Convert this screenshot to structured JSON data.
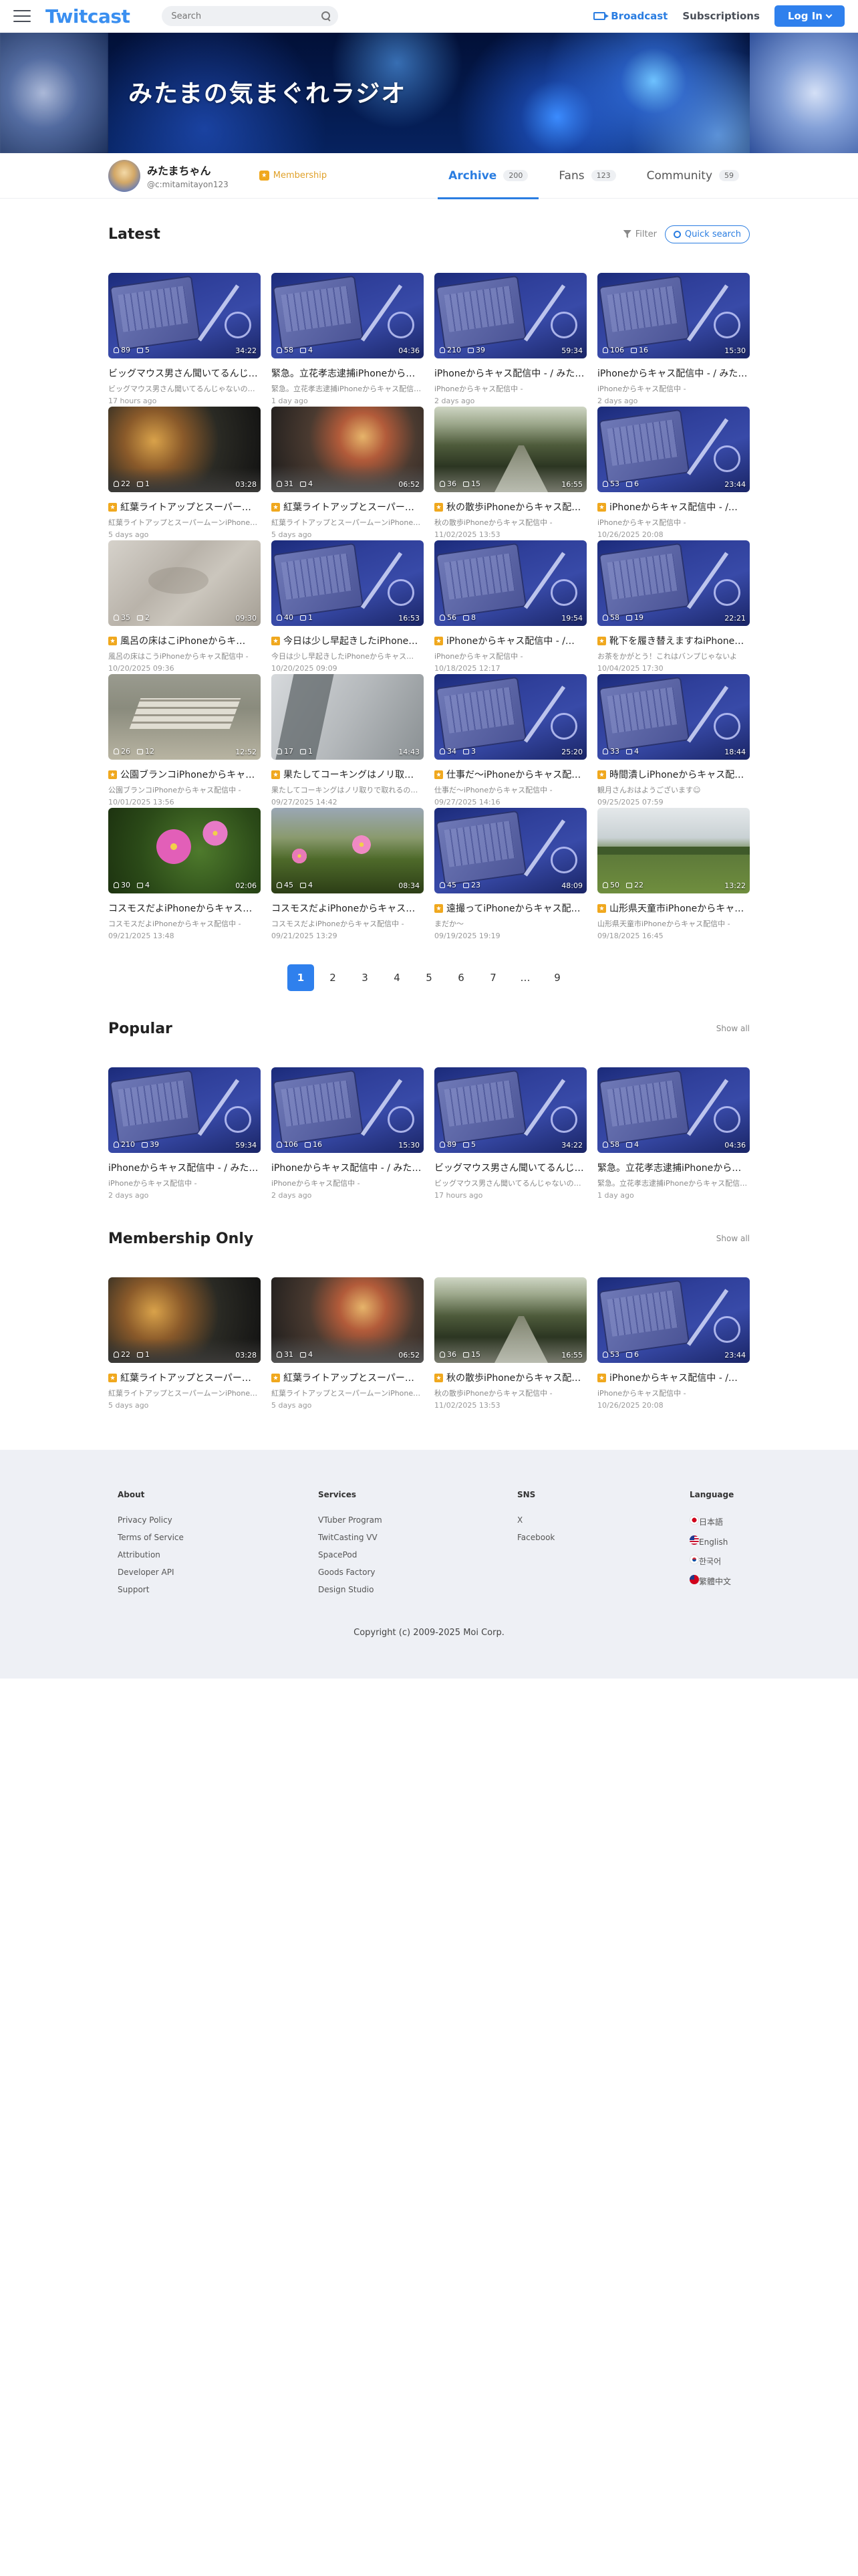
{
  "header": {
    "logo": "Twitcast",
    "search_placeholder": "Search",
    "broadcast": "Broadcast",
    "subscriptions": "Subscriptions",
    "login": "Log In"
  },
  "banner": {
    "title": "みたまの気まぐれラジオ"
  },
  "profile": {
    "name": "みたまちゃん",
    "id": "@c:mitamitayon123",
    "membership": "Membership",
    "tabs": [
      {
        "label": "Archive",
        "count": "200"
      },
      {
        "label": "Fans",
        "count": "123"
      },
      {
        "label": "Community",
        "count": "59"
      }
    ]
  },
  "latest": {
    "title": "Latest",
    "filter": "Filter",
    "quick_search": "Quick search",
    "items": [
      {
        "views": "89",
        "comments": "5",
        "duration": "34:22",
        "title": "ビッグマウス男さん聞いてるんじゃ…",
        "sub": "ビッグマウス男さん聞いてるんじゃないの…",
        "date": "17 hours ago",
        "member": false,
        "thumb": "phone"
      },
      {
        "views": "58",
        "comments": "4",
        "duration": "04:36",
        "title": "緊急。立花孝志逮捕iPhoneから…",
        "sub": "緊急。立花孝志逮捕iPhoneからキャス配信…",
        "date": "1 day ago",
        "member": false,
        "thumb": "phone"
      },
      {
        "views": "210",
        "comments": "39",
        "duration": "59:34",
        "title": "iPhoneからキャス配信中 - / みた…",
        "sub": "iPhoneからキャス配信中 -",
        "date": "2 days ago",
        "member": false,
        "thumb": "phone"
      },
      {
        "views": "106",
        "comments": "16",
        "duration": "15:30",
        "title": "iPhoneからキャス配信中 - / みた…",
        "sub": "iPhoneからキャス配信中 -",
        "date": "2 days ago",
        "member": false,
        "thumb": "phone"
      },
      {
        "views": "22",
        "comments": "1",
        "duration": "03:28",
        "title": "紅葉ライトアップとスーパー…",
        "sub": "紅葉ライトアップとスーパームーンiPhone…",
        "date": "5 days ago",
        "member": true,
        "thumb": "autumn"
      },
      {
        "views": "31",
        "comments": "4",
        "duration": "06:52",
        "title": "紅葉ライトアップとスーパー…",
        "sub": "紅葉ライトアップとスーパームーンiPhone…",
        "date": "5 days ago",
        "member": true,
        "thumb": "autumn2"
      },
      {
        "views": "36",
        "comments": "15",
        "duration": "16:55",
        "title": "秋の散歩iPhoneからキャス配…",
        "sub": "秋の散歩iPhoneからキャス配信中 -",
        "date": "11/02/2025 13:53",
        "member": true,
        "thumb": "forest"
      },
      {
        "views": "53",
        "comments": "6",
        "duration": "23:44",
        "title": "iPhoneからキャス配信中 - /…",
        "sub": "iPhoneからキャス配信中 -",
        "date": "10/26/2025 20:08",
        "member": true,
        "thumb": "phone"
      },
      {
        "views": "35",
        "comments": "2",
        "duration": "09:30",
        "title": "風呂の床はこiPhoneからキ…",
        "sub": "風呂の床はこうiPhoneからキャス配信中 -",
        "date": "10/20/2025 09:36",
        "member": true,
        "thumb": "floor"
      },
      {
        "views": "40",
        "comments": "1",
        "duration": "16:53",
        "title": "今日は少し早起きしたiPhone…",
        "sub": "今日は少し早起きしたiPhoneからキャス…",
        "date": "10/20/2025 09:09",
        "member": true,
        "thumb": "phone"
      },
      {
        "views": "56",
        "comments": "8",
        "duration": "19:54",
        "title": "iPhoneからキャス配信中 - /…",
        "sub": "iPhoneからキャス配信中 -",
        "date": "10/18/2025 12:17",
        "member": true,
        "thumb": "phone"
      },
      {
        "views": "58",
        "comments": "19",
        "duration": "22:21",
        "title": "靴下を履き替えますねiPhone…",
        "sub": "お茶をかがとう！これはバンプじゃないよ",
        "date": "10/04/2025 17:30",
        "member": true,
        "thumb": "phone"
      },
      {
        "views": "26",
        "comments": "12",
        "duration": "12:52",
        "title": "公園ブランコiPhoneからキャ…",
        "sub": "公園ブランコiPhoneからキャス配信中 -",
        "date": "10/01/2025 13:56",
        "member": true,
        "thumb": "bench"
      },
      {
        "views": "17",
        "comments": "1",
        "duration": "14:43",
        "title": "果たしてコーキングはノリ取…",
        "sub": "果たしてコーキングはノリ取りで取れるの…",
        "date": "09/27/2025 14:42",
        "member": true,
        "thumb": "room"
      },
      {
        "views": "34",
        "comments": "3",
        "duration": "25:20",
        "title": "仕事だ〜iPhoneからキャス配…",
        "sub": "仕事だ〜iPhoneからキャス配信中 -",
        "date": "09/27/2025 14:16",
        "member": true,
        "thumb": "phone"
      },
      {
        "views": "33",
        "comments": "4",
        "duration": "18:44",
        "title": "時間潰しiPhoneからキャス配…",
        "sub": "観月さんおはようございます☺",
        "date": "09/25/2025 07:59",
        "member": true,
        "thumb": "phone"
      },
      {
        "views": "30",
        "comments": "4",
        "duration": "02:06",
        "title": "コスモスだよiPhoneからキャス…",
        "sub": "コスモスだよiPhoneからキャス配信中 -",
        "date": "09/21/2025 13:48",
        "member": false,
        "thumb": "cosmos"
      },
      {
        "views": "45",
        "comments": "4",
        "duration": "08:34",
        "title": "コスモスだよiPhoneからキャス…",
        "sub": "コスモスだよiPhoneからキャス配信中 -",
        "date": "09/21/2025 13:29",
        "member": false,
        "thumb": "cosmos2"
      },
      {
        "views": "45",
        "comments": "23",
        "duration": "48:09",
        "title": "遠撮ってiPhoneからキャス配…",
        "sub": "まだか〜",
        "date": "09/19/2025 19:19",
        "member": true,
        "thumb": "phone"
      },
      {
        "views": "50",
        "comments": "22",
        "duration": "13:22",
        "title": "山形県天童市iPhoneからキャ…",
        "sub": "山形県天童市iPhoneからキャス配信中 -",
        "date": "09/18/2025 16:45",
        "member": true,
        "thumb": "field"
      }
    ]
  },
  "pagination": [
    "1",
    "2",
    "3",
    "4",
    "5",
    "6",
    "7",
    "…",
    "9"
  ],
  "popular": {
    "title": "Popular",
    "show_all": "Show all",
    "items": [
      {
        "views": "210",
        "comments": "39",
        "duration": "59:34",
        "title": "iPhoneからキャス配信中 - / みた…",
        "sub": "iPhoneからキャス配信中 -",
        "date": "2 days ago",
        "member": false,
        "thumb": "phone"
      },
      {
        "views": "106",
        "comments": "16",
        "duration": "15:30",
        "title": "iPhoneからキャス配信中 - / みた…",
        "sub": "iPhoneからキャス配信中 -",
        "date": "2 days ago",
        "member": false,
        "thumb": "phone"
      },
      {
        "views": "89",
        "comments": "5",
        "duration": "34:22",
        "title": "ビッグマウス男さん聞いてるんじ…",
        "sub": "ビッグマウス男さん聞いてるんじゃないの…",
        "date": "17 hours ago",
        "member": false,
        "thumb": "phone"
      },
      {
        "views": "58",
        "comments": "4",
        "duration": "04:36",
        "title": "緊急。立花孝志逮捕iPhoneから…",
        "sub": "緊急。立花孝志逮捕iPhoneからキャス配信…",
        "date": "1 day ago",
        "member": false,
        "thumb": "phone"
      }
    ]
  },
  "membership_only": {
    "title": "Membership Only",
    "show_all": "Show all",
    "items": [
      {
        "views": "22",
        "comments": "1",
        "duration": "03:28",
        "title": "紅葉ライトアップとスーパー…",
        "sub": "紅葉ライトアップとスーパームーンiPhone…",
        "date": "5 days ago",
        "member": true,
        "thumb": "autumn"
      },
      {
        "views": "31",
        "comments": "4",
        "duration": "06:52",
        "title": "紅葉ライトアップとスーパー…",
        "sub": "紅葉ライトアップとスーパームーンiPhone…",
        "date": "5 days ago",
        "member": true,
        "thumb": "autumn2"
      },
      {
        "views": "36",
        "comments": "15",
        "duration": "16:55",
        "title": "秋の散歩iPhoneからキャス配…",
        "sub": "秋の散歩iPhoneからキャス配信中 -",
        "date": "11/02/2025 13:53",
        "member": true,
        "thumb": "forest"
      },
      {
        "views": "53",
        "comments": "6",
        "duration": "23:44",
        "title": "iPhoneからキャス配信中 - /…",
        "sub": "iPhoneからキャス配信中 -",
        "date": "10/26/2025 20:08",
        "member": true,
        "thumb": "phone"
      }
    ]
  },
  "footer": {
    "about": {
      "title": "About",
      "links": [
        "Privacy Policy",
        "Terms of Service",
        "Attribution",
        "Developer API",
        "Support"
      ]
    },
    "services": {
      "title": "Services",
      "links": [
        "VTuber Program",
        "TwitCasting VV",
        "SpacePod",
        "Goods Factory",
        "Design Studio"
      ]
    },
    "sns": {
      "title": "SNS",
      "links": [
        "X",
        "Facebook"
      ]
    },
    "language": {
      "title": "Language",
      "links": [
        "日本語",
        "English",
        "한국어",
        "繁體中文"
      ]
    },
    "copyright": "Copyright (c) 2009-2025 Moi Corp."
  }
}
